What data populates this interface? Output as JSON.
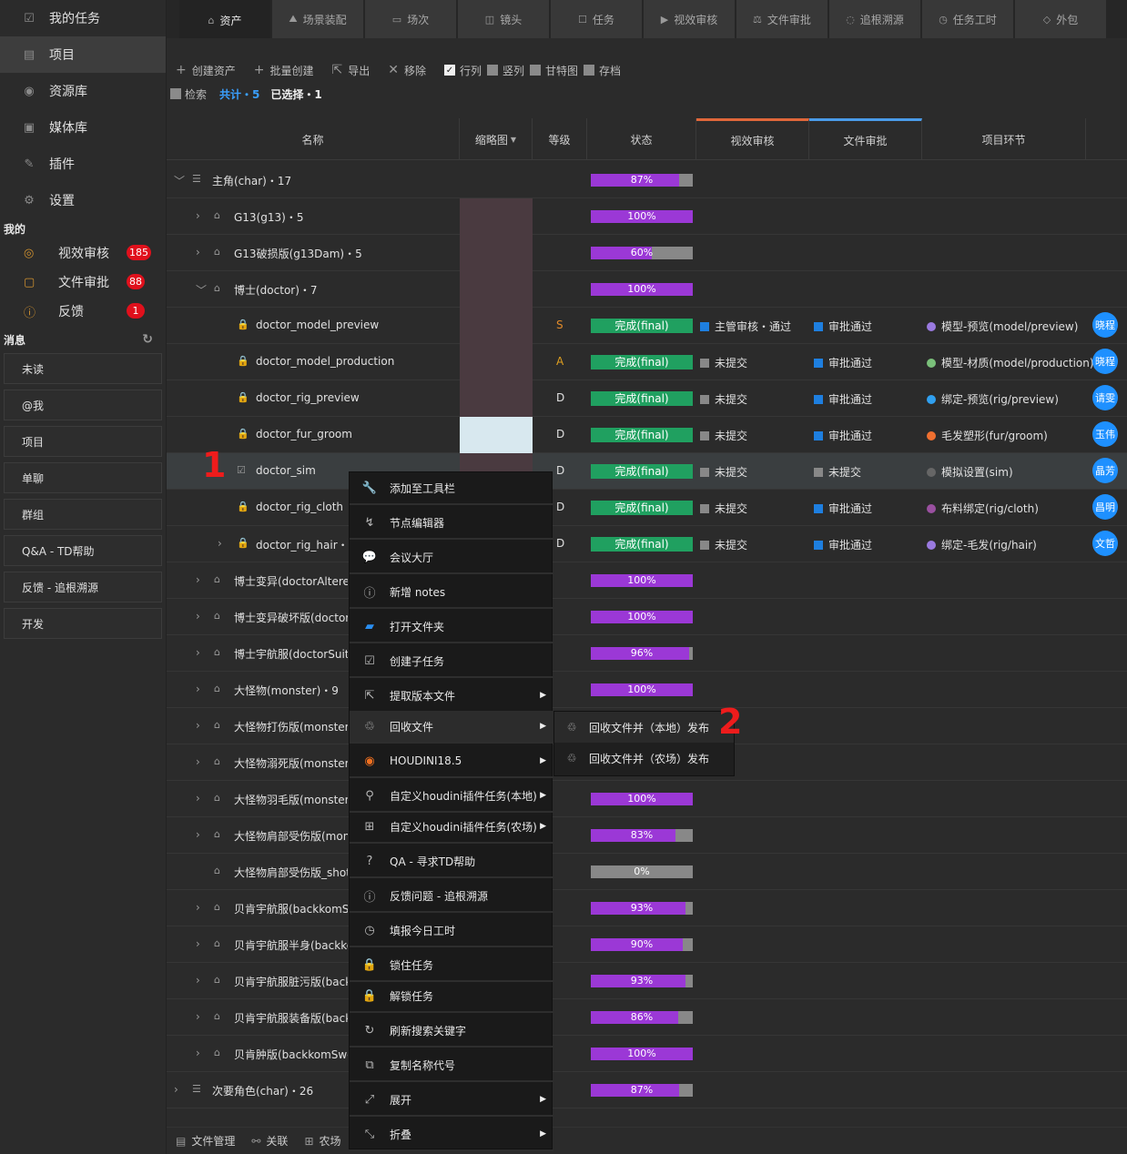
{
  "sidebar": {
    "nav": [
      {
        "label": "我的任务",
        "icon": "checkbox-icon"
      },
      {
        "label": "项目",
        "icon": "project-icon"
      },
      {
        "label": "资源库",
        "icon": "library-icon"
      },
      {
        "label": "媒体库",
        "icon": "media-icon"
      },
      {
        "label": "插件",
        "icon": "plugin-icon"
      },
      {
        "label": "设置",
        "icon": "gear-icon"
      }
    ],
    "my_title": "我的",
    "my": [
      {
        "label": "视效审核",
        "badge": "185",
        "icon": "eye-icon"
      },
      {
        "label": "文件审批",
        "badge": "88",
        "icon": "folder-icon"
      },
      {
        "label": "反馈",
        "badge": "1",
        "icon": "alert-icon"
      }
    ],
    "msg_title": "消息",
    "messages": [
      "未读",
      "@我",
      "项目",
      "单聊",
      "群组",
      "Q&A - TD帮助",
      "反馈 - 追根溯源",
      "开发"
    ]
  },
  "tabs": [
    {
      "label": "资产",
      "icon": "asset-icon"
    },
    {
      "label": "场景装配",
      "icon": "scene-icon"
    },
    {
      "label": "场次",
      "icon": "sequence-icon"
    },
    {
      "label": "镜头",
      "icon": "camera-icon"
    },
    {
      "label": "任务",
      "icon": "task-icon"
    },
    {
      "label": "视效审核",
      "icon": "review-icon"
    },
    {
      "label": "文件审批",
      "icon": "approve-icon"
    },
    {
      "label": "追根溯源",
      "icon": "trace-icon"
    },
    {
      "label": "任务工时",
      "icon": "clock-icon"
    },
    {
      "label": "外包",
      "icon": "outsource-icon"
    }
  ],
  "toolbar": {
    "create": "创建资产",
    "batch": "批量创建",
    "export": "导出",
    "remove": "移除",
    "row": "行列",
    "col": "竖列",
    "gantt": "甘特图",
    "archive": "存档"
  },
  "filter": {
    "search": "检索",
    "total": "共计・5",
    "selected": "已选择・1"
  },
  "columns": {
    "name": "名称",
    "thumb": "缩略图",
    "grade": "等级",
    "status": "状态",
    "vfx": "视效审核",
    "file": "文件审批",
    "step": "项目环节"
  },
  "rows": [
    {
      "type": "group",
      "name": "主角(char)・17",
      "progress": 87,
      "label": "87%"
    },
    {
      "type": "item",
      "name": "G13(g13)・5",
      "progress": 100,
      "label": "100%",
      "thumb": "dark"
    },
    {
      "type": "item",
      "name": "G13破损版(g13Dam)・5",
      "progress": 60,
      "label": "60%",
      "thumb": "dark"
    },
    {
      "type": "item",
      "open": true,
      "name": "博士(doctor)・7",
      "progress": 100,
      "label": "100%",
      "thumb": "dark"
    },
    {
      "type": "task",
      "name": "doctor_model_preview",
      "grade": "S",
      "grade_color": "#e08a2a",
      "status": "完成(final)",
      "vfx": "主管审核・通过",
      "vfx_color": "#1e7fe0",
      "file": "审批通过",
      "file_color": "#1e7fe0",
      "step": "模型-预览(model/preview)",
      "step_color": "#9a7ae0",
      "user": "晓程"
    },
    {
      "type": "task",
      "name": "doctor_model_production",
      "grade": "A",
      "grade_color": "#e0a020",
      "status": "完成(final)",
      "vfx": "未提交",
      "vfx_color": "#888888",
      "file": "审批通过",
      "file_color": "#1e7fe0",
      "step": "模型-材质(model/production)",
      "step_color": "#7ac07a",
      "user": "晓程"
    },
    {
      "type": "task",
      "name": "doctor_rig_preview",
      "grade": "D",
      "grade_color": "#e0e0e0",
      "status": "完成(final)",
      "vfx": "未提交",
      "vfx_color": "#888888",
      "file": "审批通过",
      "file_color": "#1e7fe0",
      "step": "绑定-预览(rig/preview)",
      "step_color": "#30a0f0",
      "user": "请雯"
    },
    {
      "type": "task",
      "name": "doctor_fur_groom",
      "grade": "D",
      "grade_color": "#e0e0e0",
      "status": "完成(final)",
      "vfx": "未提交",
      "vfx_color": "#888888",
      "file": "审批通过",
      "file_color": "#1e7fe0",
      "step": "毛发塑形(fur/groom)",
      "step_color": "#f07030",
      "user": "玉伟",
      "thumb": "light"
    },
    {
      "type": "task",
      "hl": true,
      "name": "doctor_sim",
      "grade": "D",
      "grade_color": "#e0e0e0",
      "status": "完成(final)",
      "vfx": "未提交",
      "vfx_color": "#888888",
      "file": "未提交",
      "file_color": "#888888",
      "step": "模拟设置(sim)",
      "step_color": "#666666",
      "user": "晶芳"
    },
    {
      "type": "task",
      "name": "doctor_rig_cloth",
      "grade": "D",
      "grade_color": "#e0e0e0",
      "status": "完成(final)",
      "vfx": "未提交",
      "vfx_color": "#888888",
      "file": "审批通过",
      "file_color": "#1e7fe0",
      "step": "布料绑定(rig/cloth)",
      "step_color": "#9a50a0",
      "user": "昌明"
    },
    {
      "type": "task",
      "name": "doctor_rig_hair・1",
      "grade": "D",
      "grade_color": "#e0e0e0",
      "status": "完成(final)",
      "vfx": "未提交",
      "vfx_color": "#888888",
      "file": "审批通过",
      "file_color": "#1e7fe0",
      "step": "绑定-毛发(rig/hair)",
      "step_color": "#9a7ae0",
      "user": "文哲"
    },
    {
      "type": "item",
      "name": "博士变异(doctorAltered",
      "progress": 100,
      "label": "100%"
    },
    {
      "type": "item",
      "name": "博士变异破坏版(doctor",
      "progress": 100,
      "label": "100%"
    },
    {
      "type": "item",
      "name": "博士宇航服(doctorSuit)",
      "progress": 96,
      "label": "96%"
    },
    {
      "type": "item",
      "name": "大怪物(monster)・9",
      "progress": 100,
      "label": "100%"
    },
    {
      "type": "item",
      "name": "大怪物打伤版(monster",
      "progress": 100,
      "label": ""
    },
    {
      "type": "item",
      "name": "大怪物溺死版(monster",
      "progress": 100,
      "label": ""
    },
    {
      "type": "item",
      "name": "大怪物羽毛版(monster_",
      "progress": 100,
      "label": "100%"
    },
    {
      "type": "item",
      "name": "大怪物肩部受伤版(mon",
      "progress": 83,
      "label": "83%"
    },
    {
      "type": "item",
      "nochev": true,
      "name": "大怪物肩部受伤版_shot",
      "progress": 0,
      "label": "0%"
    },
    {
      "type": "item",
      "name": "贝肯宇航服(backkomSu",
      "progress": 93,
      "label": "93%"
    },
    {
      "type": "item",
      "name": "贝肯宇航服半身(backko",
      "progress": 90,
      "label": "90%"
    },
    {
      "type": "item",
      "name": "贝肯宇航服脏污版(back",
      "progress": 93,
      "label": "93%"
    },
    {
      "type": "item",
      "name": "贝肯宇航服装备版(back",
      "progress": 86,
      "label": "86%"
    },
    {
      "type": "item",
      "name": "贝肯肿版(backkomSwe",
      "progress": 100,
      "label": "100%"
    },
    {
      "type": "group",
      "name": "次要角色(char)・26",
      "progress": 87,
      "label": "87%"
    }
  ],
  "menu": [
    {
      "label": "添加至工具栏",
      "icon": "wrench-icon"
    },
    {
      "label": "节点编辑器",
      "icon": "node-editor-icon"
    },
    {
      "label": "会议大厅",
      "icon": "chat-icon"
    },
    {
      "label": "新增 notes",
      "icon": "note-icon"
    },
    {
      "label": "打开文件夹",
      "icon": "folder-open-icon"
    },
    {
      "label": "创建子任务",
      "icon": "subtask-icon"
    },
    {
      "label": "提取版本文件",
      "icon": "extract-icon",
      "sub": true
    },
    {
      "label": "回收文件",
      "icon": "recycle-icon",
      "sub": true,
      "active": true
    },
    {
      "label": "HOUDINI18.5",
      "icon": "houdini-icon",
      "sub": true
    },
    {
      "label": "自定义houdini插件任务(本地)",
      "icon": "pin-icon",
      "sub": true
    },
    {
      "label": "自定义houdini插件任务(农场)",
      "icon": "network-icon",
      "sub": true
    },
    {
      "label": "QA - 寻求TD帮助",
      "icon": "question-icon"
    },
    {
      "label": "反馈问题 - 追根溯源",
      "icon": "info-icon"
    },
    {
      "label": "填报今日工时",
      "icon": "clock-icon"
    },
    {
      "label": "锁住任务",
      "icon": "lock-icon"
    },
    {
      "label": "解锁任务",
      "icon": "unlock-icon"
    },
    {
      "label": "刷新搜索关键字",
      "icon": "refresh-icon"
    },
    {
      "label": "复制名称代号",
      "icon": "copy-icon"
    },
    {
      "label": "展开",
      "icon": "expand-icon",
      "sub": true
    },
    {
      "label": "折叠",
      "icon": "collapse-icon",
      "sub": true
    }
  ],
  "submenu": [
    "回收文件并（本地）发布",
    "回收文件并（农场）发布"
  ],
  "annotations": [
    "1",
    "2"
  ],
  "bottom": [
    "文件管理",
    "关联",
    "农场"
  ],
  "colors": {
    "progress": "#9b38d6",
    "status": "#20a060",
    "badge": "#e0101c",
    "accent": "#3aa0ff"
  }
}
